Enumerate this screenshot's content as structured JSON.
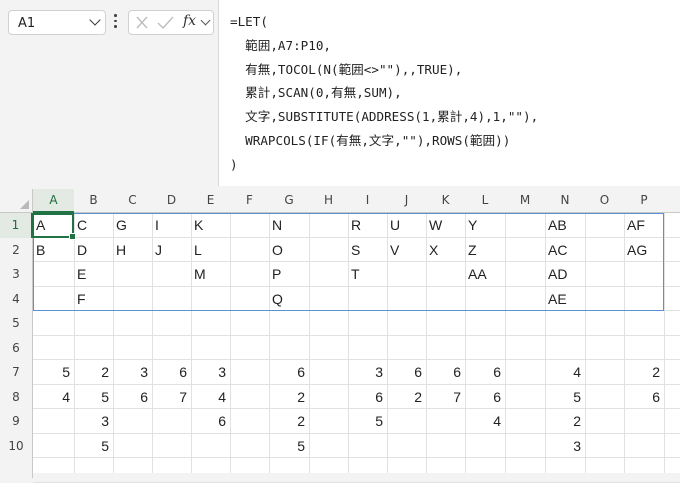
{
  "name_box": {
    "value": "A1"
  },
  "formula_bar": {
    "fx_label": "fx",
    "lines": [
      "=LET(",
      "  範囲,A7:P10,",
      "  有無,TOCOL(N(範囲<>\"\"),,TRUE),",
      "  累計,SCAN(0,有無,SUM),",
      "  文字,SUBSTITUTE(ADDRESS(1,累計,4),1,\"\"),",
      "  WRAPCOLS(IF(有無,文字,\"\"),ROWS(範囲))",
      ")"
    ]
  },
  "sheet": {
    "columns": [
      "A",
      "B",
      "C",
      "D",
      "E",
      "F",
      "G",
      "H",
      "I",
      "J",
      "K",
      "L",
      "M",
      "N",
      "O",
      "P"
    ],
    "rows": [
      "1",
      "2",
      "3",
      "4",
      "5",
      "6",
      "7",
      "8",
      "9",
      "10"
    ],
    "selected_column": "A",
    "selected_row": "1",
    "active_cell": "A1",
    "cells": [
      [
        "A",
        "C",
        "G",
        "I",
        "K",
        "",
        "N",
        "",
        "R",
        "U",
        "W",
        "Y",
        "",
        "AB",
        "",
        "AF"
      ],
      [
        "B",
        "D",
        "H",
        "J",
        "L",
        "",
        "O",
        "",
        "S",
        "V",
        "X",
        "Z",
        "",
        "AC",
        "",
        "AG"
      ],
      [
        "",
        "E",
        "",
        "",
        "M",
        "",
        "P",
        "",
        "T",
        "",
        "",
        "AA",
        "",
        "AD",
        "",
        ""
      ],
      [
        "",
        "F",
        "",
        "",
        "",
        "",
        "Q",
        "",
        "",
        "",
        "",
        "",
        "",
        "AE",
        "",
        ""
      ],
      [
        "",
        "",
        "",
        "",
        "",
        "",
        "",
        "",
        "",
        "",
        "",
        "",
        "",
        "",
        "",
        ""
      ],
      [
        "",
        "",
        "",
        "",
        "",
        "",
        "",
        "",
        "",
        "",
        "",
        "",
        "",
        "",
        "",
        ""
      ],
      [
        "5",
        "2",
        "3",
        "6",
        "3",
        "",
        "6",
        "",
        "3",
        "6",
        "6",
        "6",
        "",
        "4",
        "",
        "2"
      ],
      [
        "4",
        "5",
        "6",
        "7",
        "4",
        "",
        "2",
        "",
        "6",
        "2",
        "7",
        "6",
        "",
        "5",
        "",
        "6"
      ],
      [
        "",
        "3",
        "",
        "",
        "6",
        "",
        "2",
        "",
        "5",
        "",
        "",
        "4",
        "",
        "2",
        "",
        ""
      ],
      [
        "",
        "5",
        "",
        "",
        "",
        "",
        "5",
        "",
        "",
        "",
        "",
        "",
        "",
        "3",
        "",
        ""
      ]
    ]
  }
}
